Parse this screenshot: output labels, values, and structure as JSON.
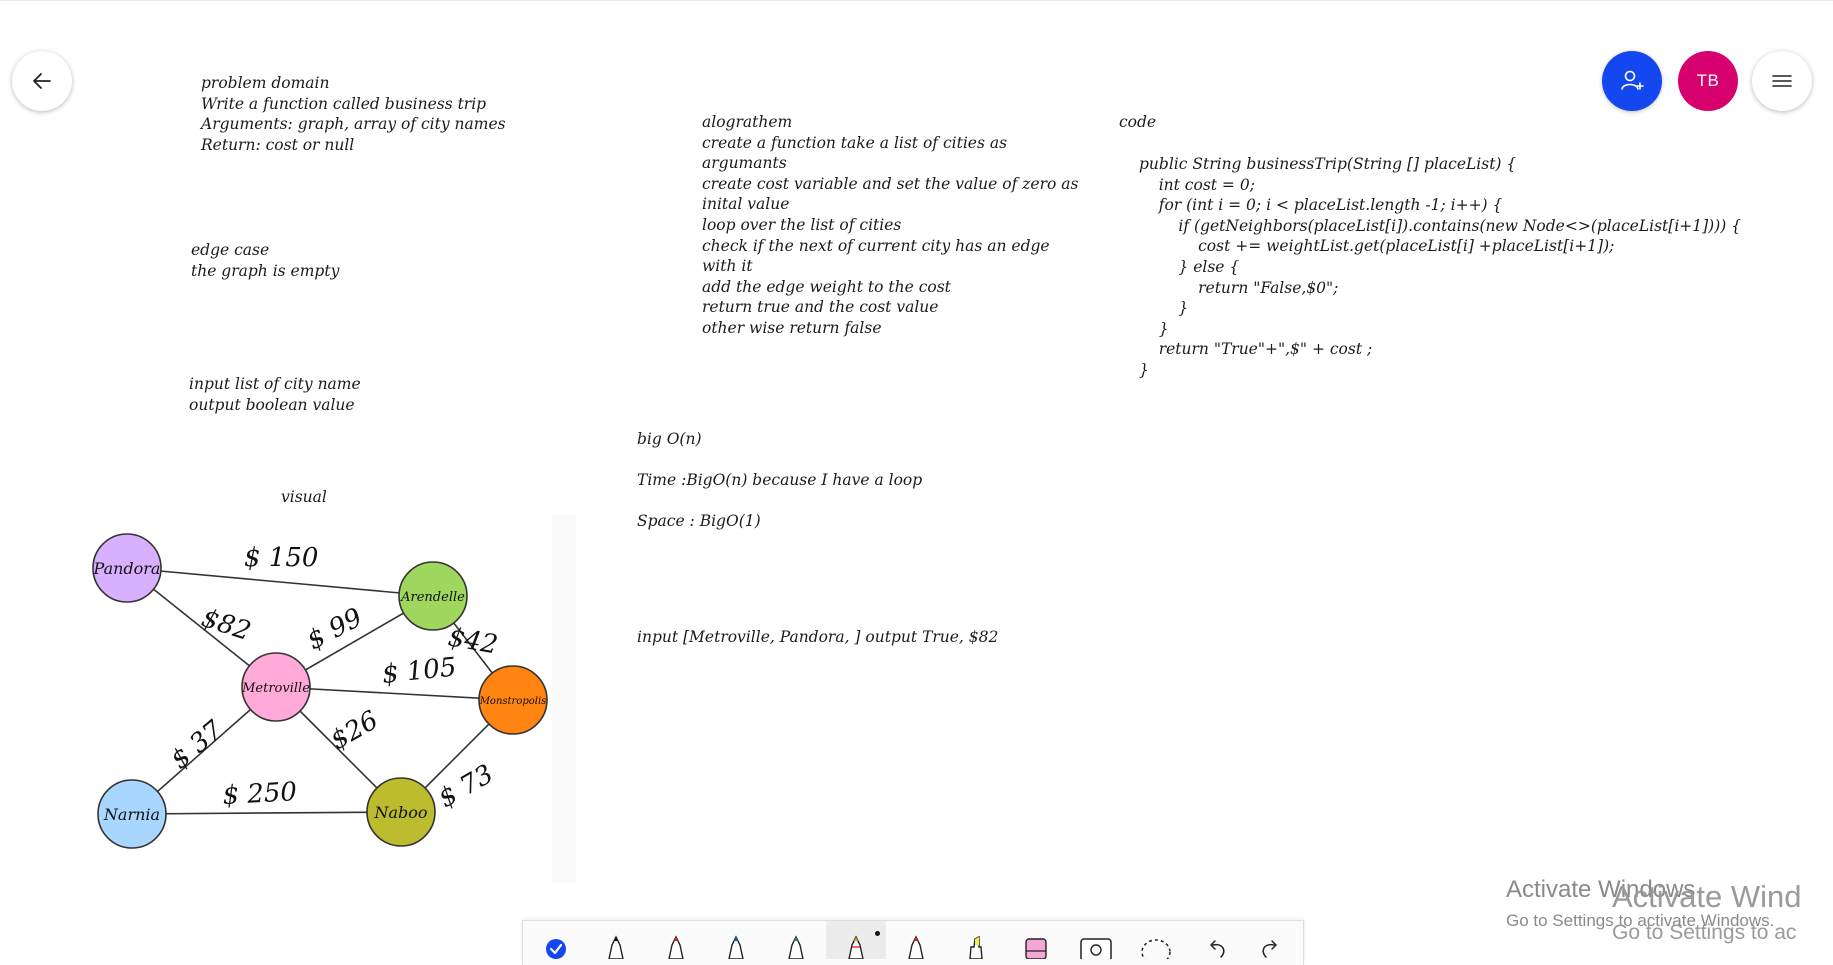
{
  "nav": {
    "back_icon": "arrow-left-icon",
    "share_icon": "add-person-icon",
    "avatar_initials": "TB",
    "menu_icon": "hamburger-menu-icon"
  },
  "notes": {
    "problem_domain": "problem domain\nWrite a function called business trip\nArguments: graph, array of city names\nReturn: cost or null",
    "edge_case": "edge case\nthe graph is empty",
    "io": "input list of city name\noutput boolean value",
    "visual_label": "visual",
    "algorithm": "alograthem\ncreate a function take a list of cities as\nargumants\ncreate cost variable and set the value of zero as\ninital value\nloop over the list of cities\ncheck if the next of current city has an edge\nwith it\nadd the edge weight to the cost\nreturn true and the cost value\nother wise return false",
    "code_label": "code",
    "code": "public String businessTrip(String [] placeList) {\n    int cost = 0;\n    for (int i = 0; i < placeList.length -1; i++) {\n        if (getNeighbors(placeList[i]).contains(new Node<>(placeList[i+1]))) {\n            cost += weightList.get(placeList[i] +placeList[i+1]);\n        } else {\n            return \"False,$0\";\n        }\n    }\n    return \"True\"+\",$\" + cost ;\n}",
    "big_o": "big O(n)",
    "time": "Time :BigO(n) because I have a loop",
    "space": "Space : BigO(1)",
    "example": "input [Metroville, Pandora, ] output True, $82"
  },
  "graph": {
    "nodes": {
      "pandora": {
        "label": "Pandora",
        "color": "#d7b0ff"
      },
      "arendelle": {
        "label": "Arendelle",
        "color": "#9ed65e"
      },
      "metroville": {
        "label": "Metroville",
        "color": "#ffaad8"
      },
      "monstropolis": {
        "label": "Monstropolis",
        "color": "#ff8412"
      },
      "narnia": {
        "label": "Narnia",
        "color": "#a8d6ff"
      },
      "naboo": {
        "label": "Naboo",
        "color": "#bcbc2e"
      }
    },
    "edges": {
      "pandora_arendelle": "$ 150",
      "pandora_metroville": "$82",
      "metroville_arendelle": "$ 99",
      "arendelle_monstropolis": "$42",
      "metroville_monstropolis": "$ 105",
      "metroville_narnia": "$ 37",
      "metroville_naboo": "$26",
      "narnia_naboo": "$ 250",
      "naboo_monstropolis": "$ 73"
    }
  },
  "toolbar": {
    "tools": [
      "select-check-icon",
      "pen-black-icon",
      "pen-red-icon",
      "pen-blue-icon",
      "pen-green-icon",
      "pen-rainbow-icon",
      "pen-red-icon",
      "highlighter-yellow-icon",
      "eraser-icon",
      "image-icon",
      "lasso-icon",
      "undo-icon",
      "redo-icon"
    ]
  },
  "watermark": {
    "line1": "Activate Windows",
    "line2": "Go to Settings to activate Windows.",
    "ghost1": "Activate Wind",
    "ghost2": "Go to Settings to ac"
  }
}
